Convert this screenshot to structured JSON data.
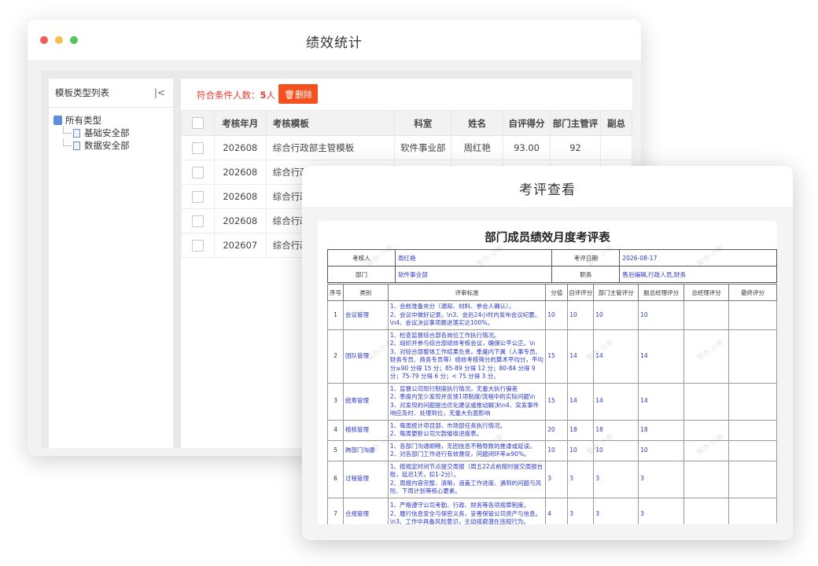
{
  "back_window": {
    "title": "绩效统计",
    "traffic_lights": {
      "close": "#ec5f57",
      "minimize": "#f4bf4f",
      "maximize": "#58c35b"
    },
    "sidebar": {
      "header": "模板类型列表",
      "collapse_icon": "collapse-left-icon",
      "tree": {
        "root": "所有类型",
        "children": [
          "基础安全部",
          "数据安全部"
        ]
      }
    },
    "toolbar": {
      "count_prefix": "符合条件人数：",
      "count_value": "5",
      "count_suffix": "人",
      "delete_label": "删除",
      "delete_color": "#f4511e"
    },
    "table": {
      "headers": [
        "考核年月",
        "考核模板",
        "科室",
        "姓名",
        "自评得分",
        "部门主管评",
        "副总"
      ],
      "rows": [
        [
          "202608",
          "综合行政部主管模板",
          "软件事业部",
          "周红艳",
          "93.00",
          "92",
          ""
        ],
        [
          "202608",
          "综合行政",
          "",
          "",
          "",
          "",
          ""
        ],
        [
          "202608",
          "综合行政",
          "",
          "",
          "",
          "",
          ""
        ],
        [
          "202608",
          "综合行政",
          "",
          "",
          "",
          "",
          ""
        ],
        [
          "202607",
          "综合行政",
          "",
          "",
          "",
          "",
          ""
        ]
      ]
    }
  },
  "front_window": {
    "title": "考评查看",
    "document": {
      "title": "部门成员绩效月度考评表",
      "watermark": "智办 小乖",
      "form": {
        "reviewer_label": "考核人",
        "reviewer_value": "周红艳",
        "date_label": "考评日期",
        "date_value": "2026-08-17",
        "dept_label": "部门",
        "dept_value": "软件事业部",
        "position_label": "职务",
        "position_value": "售后编辑,行政人员,财务"
      },
      "eval_headers": [
        "序号",
        "类别",
        "评审标准",
        "分值",
        "自评评分",
        "部门主管评分",
        "副总经理评分",
        "总经理评分",
        "最终评分"
      ],
      "eval_rows": [
        {
          "idx": "1",
          "category": "会议管理",
          "criteria": "1、会前准备充分（通知、材料、参会人确认）。\n2、会议中做好记录。\\n3、会后24小时内发布会议纪要。\\n4、会议决议事项跟进落实达100%。",
          "score": "10",
          "self": "10",
          "dept": "10",
          "vp": "10",
          "gm": "",
          "final": ""
        },
        {
          "idx": "2",
          "category": "团队管理",
          "criteria": "1、检查监督综合部各岗位工作执行情况。\n2、组织并参与综合部绩效考核会议，确保公平公正。\\n\n3、对综合部整体工作结果负责，季度内下属（人事专员、财务专员、商务专员等）绩效考核得分的算术平均分，平均分≥90 分得 15 分；85-89 分得 12 分；80-84 分得 9 分；75-79 分得 6 分；< 75 分得 3 分。",
          "score": "15",
          "self": "14",
          "dept": "14",
          "vp": "14",
          "gm": "",
          "final": ""
        },
        {
          "idx": "3",
          "category": "统筹管理",
          "criteria": "1、监督公司现行制度执行情况，无重大执行偏差\n2、季度内至少发现并反馈1项制度/流程中的实际问题\\n\n3、对发现的问题提出优化建议或推动解决\\n4、突发事件响应及时、处理到位，无重大负面影响",
          "score": "15",
          "self": "14",
          "dept": "14",
          "vp": "14",
          "gm": "",
          "final": ""
        },
        {
          "idx": "4",
          "category": "稽核管理",
          "criteria": "1、每周统计项目部、市场部任务执行情况。\n2、每周更新公司欠款催收进度表。",
          "score": "20",
          "self": "18",
          "dept": "18",
          "vp": "18",
          "gm": "",
          "final": ""
        },
        {
          "idx": "5",
          "category": "跨部门沟通",
          "criteria": "1、各部门沟通顺畅，无因信息不畅导致的推诿或延误。\n2、对各部门工作进行有效督促，问题闭环率≥90%。",
          "score": "10",
          "self": "10",
          "dept": "10",
          "vp": "10",
          "gm": "",
          "final": ""
        },
        {
          "idx": "6",
          "category": "过程管理",
          "criteria": "1、按规定时间节点提交周报（周五22点前按时提交周报台账，延迟1天，扣1-2分）。\n2、周报内容完整、清晰，涵盖工作进度、遇到的问题与风险、下周计划等核心要素。",
          "score": "3",
          "self": "3",
          "dept": "3",
          "vp": "3",
          "gm": "",
          "final": ""
        },
        {
          "idx": "7",
          "category": "合规管理",
          "criteria": "1、严格遵守公司考勤、行政、财务等各项规章制度。\n2、履行信息安全与保密义务，妥善保管公司资产与信息。\\n3、工作中具备风险意识，主动规避潜在违规行为。",
          "score": "4",
          "self": "3",
          "dept": "3",
          "vp": "3",
          "gm": "",
          "final": ""
        }
      ]
    }
  }
}
